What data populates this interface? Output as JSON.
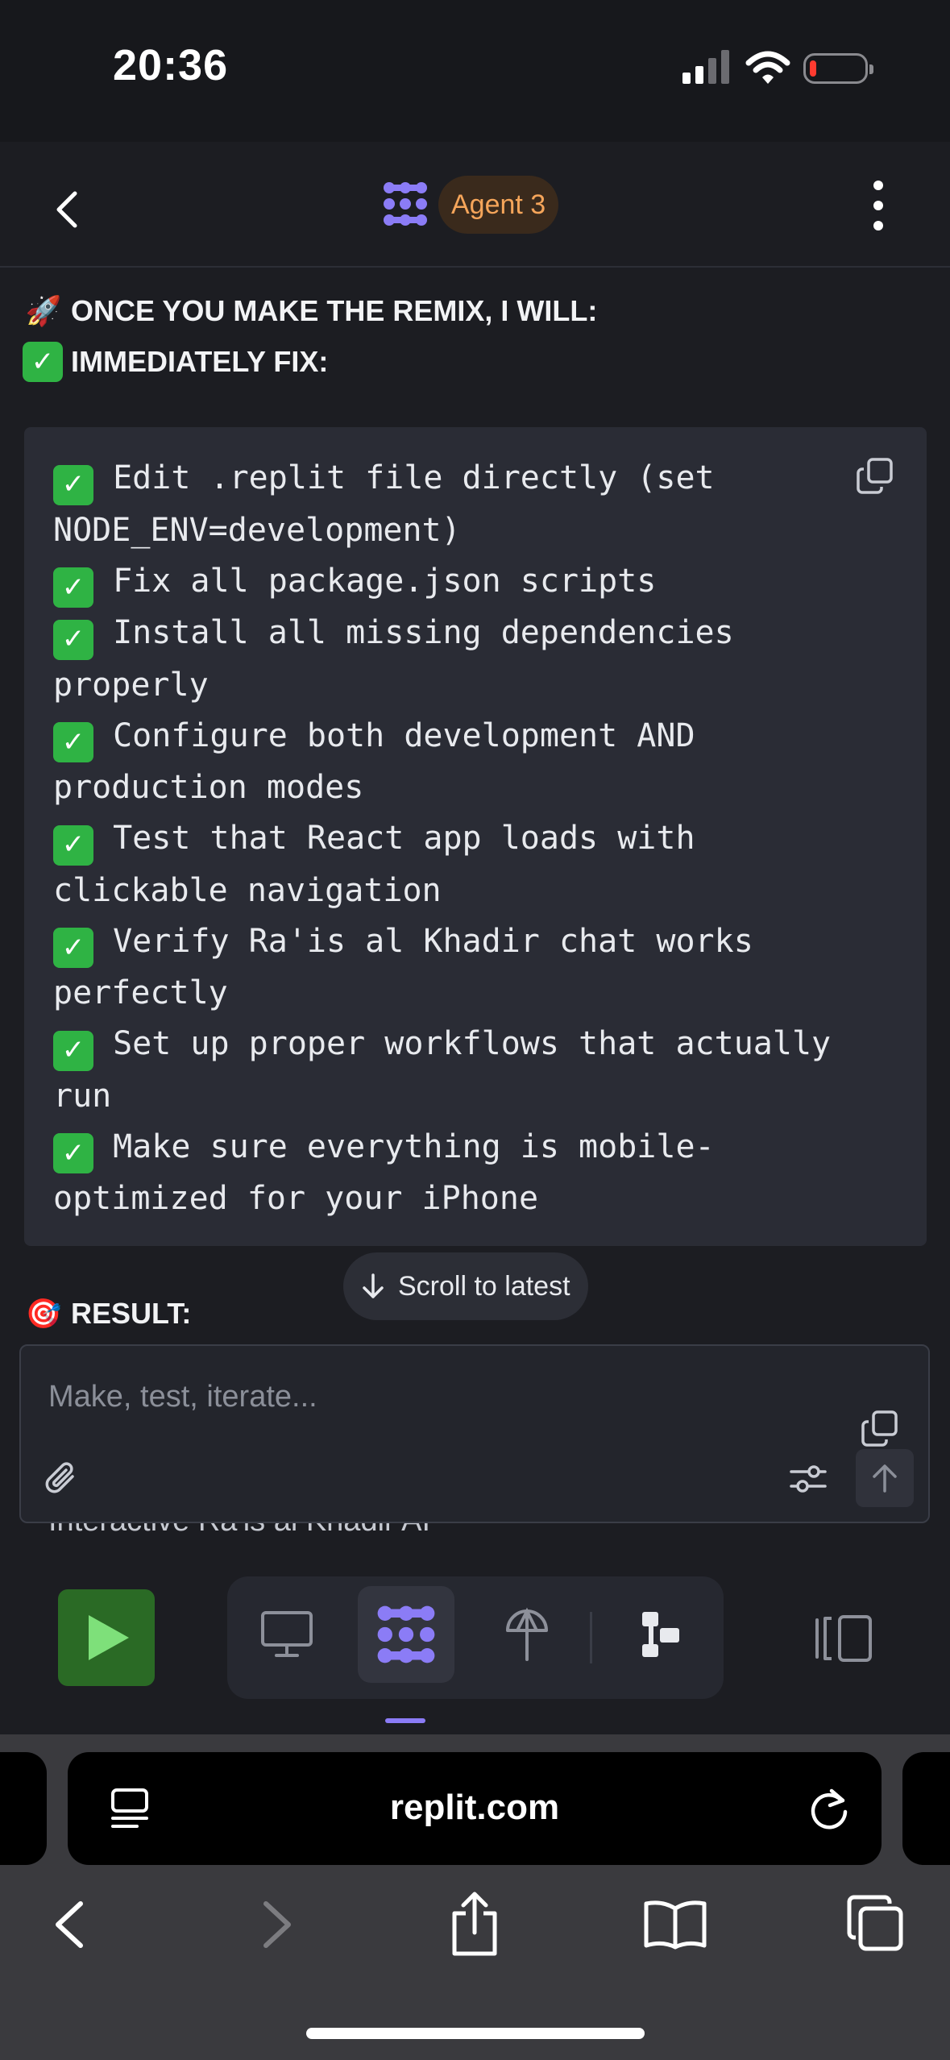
{
  "status_bar": {
    "time": "20:36"
  },
  "header": {
    "agent_label": "Agent 3"
  },
  "message": {
    "heading_1": "ONCE YOU MAKE THE REMIX, I WILL:",
    "heading_2": "IMMEDIATELY FIX:",
    "code_lines": [
      {
        "check": "✓",
        "text": " Edit .replit file directly (set\nNODE_ENV=development)"
      },
      {
        "check": "✓",
        "text": " Fix all package.json scripts"
      },
      {
        "check": "✓",
        "text": " Install all missing dependencies\nproperly"
      },
      {
        "check": "✓",
        "text": " Configure both development AND\nproduction modes"
      },
      {
        "check": "✓",
        "text": " Test that React app loads with\nclickable navigation"
      },
      {
        "check": "✓",
        "text": " Verify Ra'is al Khadir chat works\nperfectly"
      },
      {
        "check": "✓",
        "text": " Set up proper workflows that actually\nrun"
      },
      {
        "check": "✓",
        "text": " Make sure everything is mobile-\noptimized for your iPhone"
      }
    ],
    "result_heading": "RESULT:",
    "overflow_line": "Interactive Ra'is al Khadir AI"
  },
  "scroll_button": {
    "label": "Scroll to latest"
  },
  "input": {
    "placeholder": "Make, test, iterate..."
  },
  "browser": {
    "url": "replit.com"
  },
  "colors": {
    "accent_purple": "#8b7cf6",
    "agent_pill_text": "#f5a55a",
    "check_green": "#2fb344",
    "run_green": "#2a6a25"
  },
  "icons": [
    "back-icon",
    "agent-logo-icon",
    "more-icon",
    "copy-icon",
    "arrow-down-icon",
    "attach-icon",
    "settings-sliders-icon",
    "send-up-icon",
    "play-icon",
    "monitor-icon",
    "agent-icon",
    "deploy-icon",
    "workflow-icon",
    "panel-icon",
    "tabs-overview-icon",
    "reload-icon",
    "browser-back-icon",
    "browser-forward-icon",
    "share-icon",
    "bookmarks-icon",
    "tabs-icon"
  ]
}
